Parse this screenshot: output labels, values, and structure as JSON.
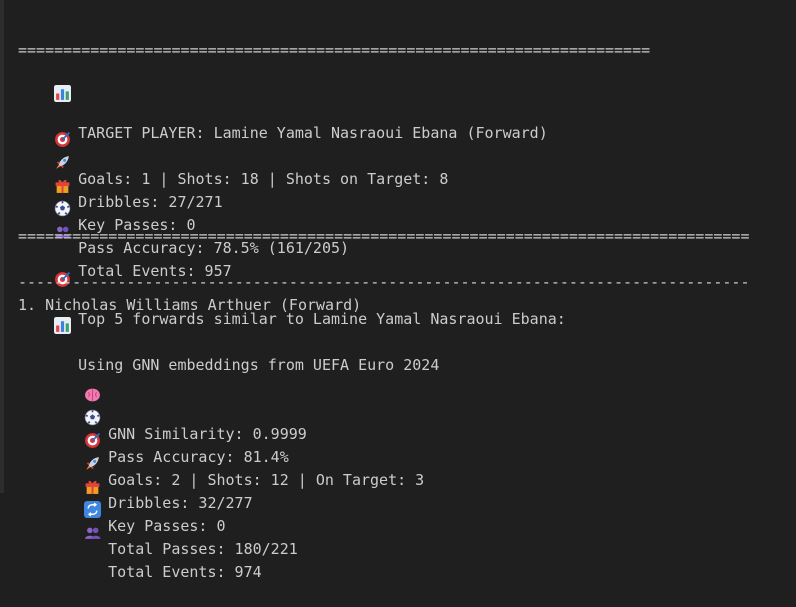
{
  "target": {
    "title": "TARGET PLAYER: Lamine Yamal Nasraoui Ebana (Forward)",
    "separator": "======================================================================",
    "goals": "Goals: 1 | Shots: 18 | Shots on Target: 8",
    "dribbles": "Dribbles: 27/271",
    "key_passes": "Key Passes: 0",
    "pass_accuracy": "Pass Accuracy: 78.5% (161/205)",
    "total_events": "Total Events: 957"
  },
  "similar": {
    "header": "Top 5 forwards similar to Lamine Yamal Nasraoui Ebana:",
    "separator": "=================================================================================",
    "source": "Using GNN embeddings from UEFA Euro 2024",
    "dash_separator": "---------------------------------------------------------------------------------"
  },
  "results": [
    {
      "title": "1. Nicholas Williams Arthuer (Forward)",
      "similarity": "GNN Similarity: 0.9999",
      "pass_accuracy": "Pass Accuracy: 81.4%",
      "goals": "Goals: 2 | Shots: 12 | On Target: 3",
      "dribbles": "Dribbles: 32/277",
      "key_passes": "Key Passes: 0",
      "total_passes": "Total Passes: 180/221",
      "total_events": "Total Events: 974"
    }
  ],
  "icons": {
    "chart": "bar-chart-icon",
    "target": "direct-hit-icon",
    "rocket": "rocket-icon",
    "gift": "gift-icon",
    "ball": "soccer-ball-icon",
    "people": "people-icon",
    "brain": "brain-icon",
    "repeat": "repeat-icon"
  },
  "colors": {
    "background": "#1f1f1f",
    "text": "#cccccc"
  }
}
